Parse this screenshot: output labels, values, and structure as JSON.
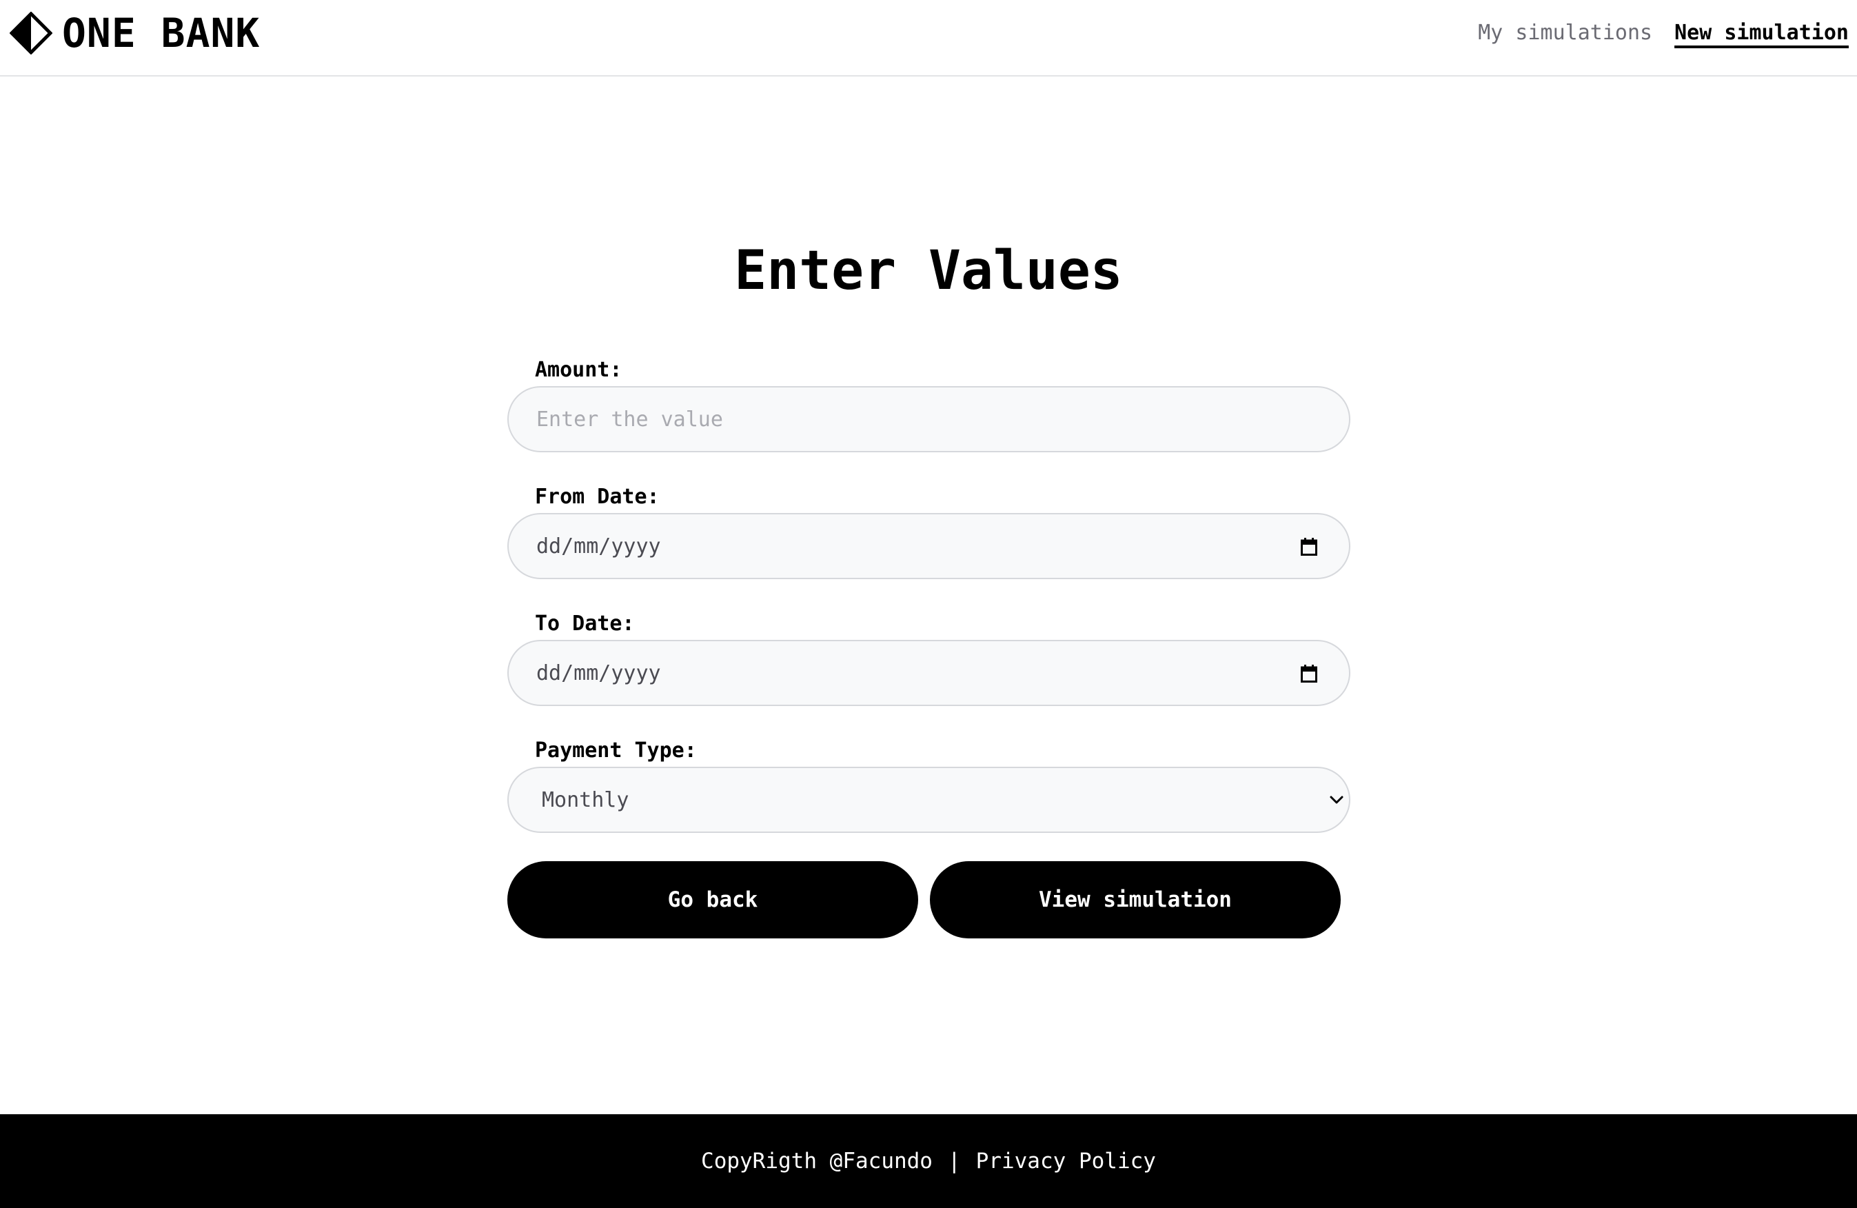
{
  "header": {
    "brand_name": "ONE BANK",
    "logo_icon": "diamond-half-filled-icon",
    "nav": {
      "my_simulations": "My simulations",
      "new_simulation": "New simulation"
    }
  },
  "main": {
    "title": "Enter Values",
    "fields": {
      "amount": {
        "label": "Amount:",
        "placeholder": "Enter the value",
        "value": ""
      },
      "from_date": {
        "label": "From Date:",
        "placeholder": "dd/mm/yyyy",
        "icon": "calendar-icon"
      },
      "to_date": {
        "label": "To Date:",
        "placeholder": "dd/mm/yyyy",
        "icon": "calendar-icon"
      },
      "payment_type": {
        "label": "Payment Type:",
        "selected": "Monthly",
        "icon": "chevron-down-icon"
      }
    },
    "buttons": {
      "go_back": "Go back",
      "view_simulation": "View simulation"
    }
  },
  "footer": {
    "copyright": "CopyRigth @Facundo",
    "separator": "|",
    "privacy": "Privacy Policy"
  },
  "colors": {
    "primary": "#000000",
    "input_bg": "#f8f9fa",
    "input_border": "#d6d8dc",
    "muted_text": "#6b6b73"
  }
}
